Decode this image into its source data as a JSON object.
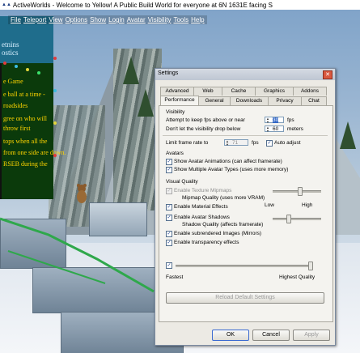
{
  "window": {
    "title": "ActiveWorlds - Welcome to Yellow! A Public Build World for everyone at 6N 1631E facing S",
    "app_icon": "activeworlds-icon"
  },
  "menu": [
    "File",
    "Teleport",
    "View",
    "Options",
    "Show",
    "Login",
    "Avatar",
    "Visibility",
    "Tools",
    "Help"
  ],
  "billboard": {
    "top_lines": [
      "etnins",
      "ostics"
    ],
    "lines": [
      "e Game",
      "e ball at a time -",
      "roadsides",
      "gree on who will",
      "throw first",
      "tops when all the",
      "from one side are down.",
      "RSEB during the"
    ]
  },
  "dialog": {
    "title": "Settings",
    "close_icon": "close-icon",
    "tabs_row1": [
      "Advanced",
      "Web",
      "Cache",
      "Graphics",
      "Addons"
    ],
    "tabs_row2": [
      "Performance",
      "General",
      "Downloads",
      "Privacy",
      "Chat"
    ],
    "active_tab": "Performance",
    "visibility": {
      "caption": "Visibility",
      "fps_label": "Attempt to keep fps above or near",
      "fps_value": "30",
      "fps_unit": "fps",
      "drop_label": "Don't let the visibility drop below",
      "drop_value": "60",
      "drop_unit": "meters",
      "limit_label": "Limit frame rate to",
      "limit_value": "71",
      "limit_unit": "fps",
      "limit_checked": false,
      "auto_adjust_label": "Auto adjust",
      "auto_adjust_checked": true
    },
    "avatars": {
      "caption": "Avatars",
      "show_animations_label": "Show Avatar Animations (can affect framerate)",
      "show_animations_checked": true,
      "show_multiple_label": "Show Multiple Avatar Types (uses more memory)",
      "show_multiple_checked": true
    },
    "visual_quality": {
      "caption": "Visual Quality",
      "texture_mipmaps_label": "Enable Texture Mipmaps",
      "texture_mipmaps_checked": true,
      "texture_mipmaps_disabled": true,
      "mipmap_quality_label": "Mipmap Quality (uses more VRAM)",
      "mipmap_quality_level": 0.55,
      "material_effects_label": "Enable Material Effects",
      "material_effects_checked": true,
      "low_label": "Low",
      "high_label": "High",
      "avatar_shadows_label": "Enable Avatar Shadows",
      "avatar_shadows_checked": true,
      "shadow_quality_label": "Shadow Quality (affects framerate)",
      "shadow_quality_level": 0.3,
      "subrendered_label": "Enable subrendered Images (Mirrors)",
      "subrendered_checked": true,
      "transparency_label": "Enable transparency effects",
      "transparency_checked": true
    },
    "overall_quality": {
      "checked": true,
      "level": 1.0,
      "fastest_label": "Fastest",
      "highest_label": "Highest Quality"
    },
    "reload_label": "Reload Default Settings",
    "ok_label": "OK",
    "cancel_label": "Cancel",
    "apply_label": "Apply"
  }
}
